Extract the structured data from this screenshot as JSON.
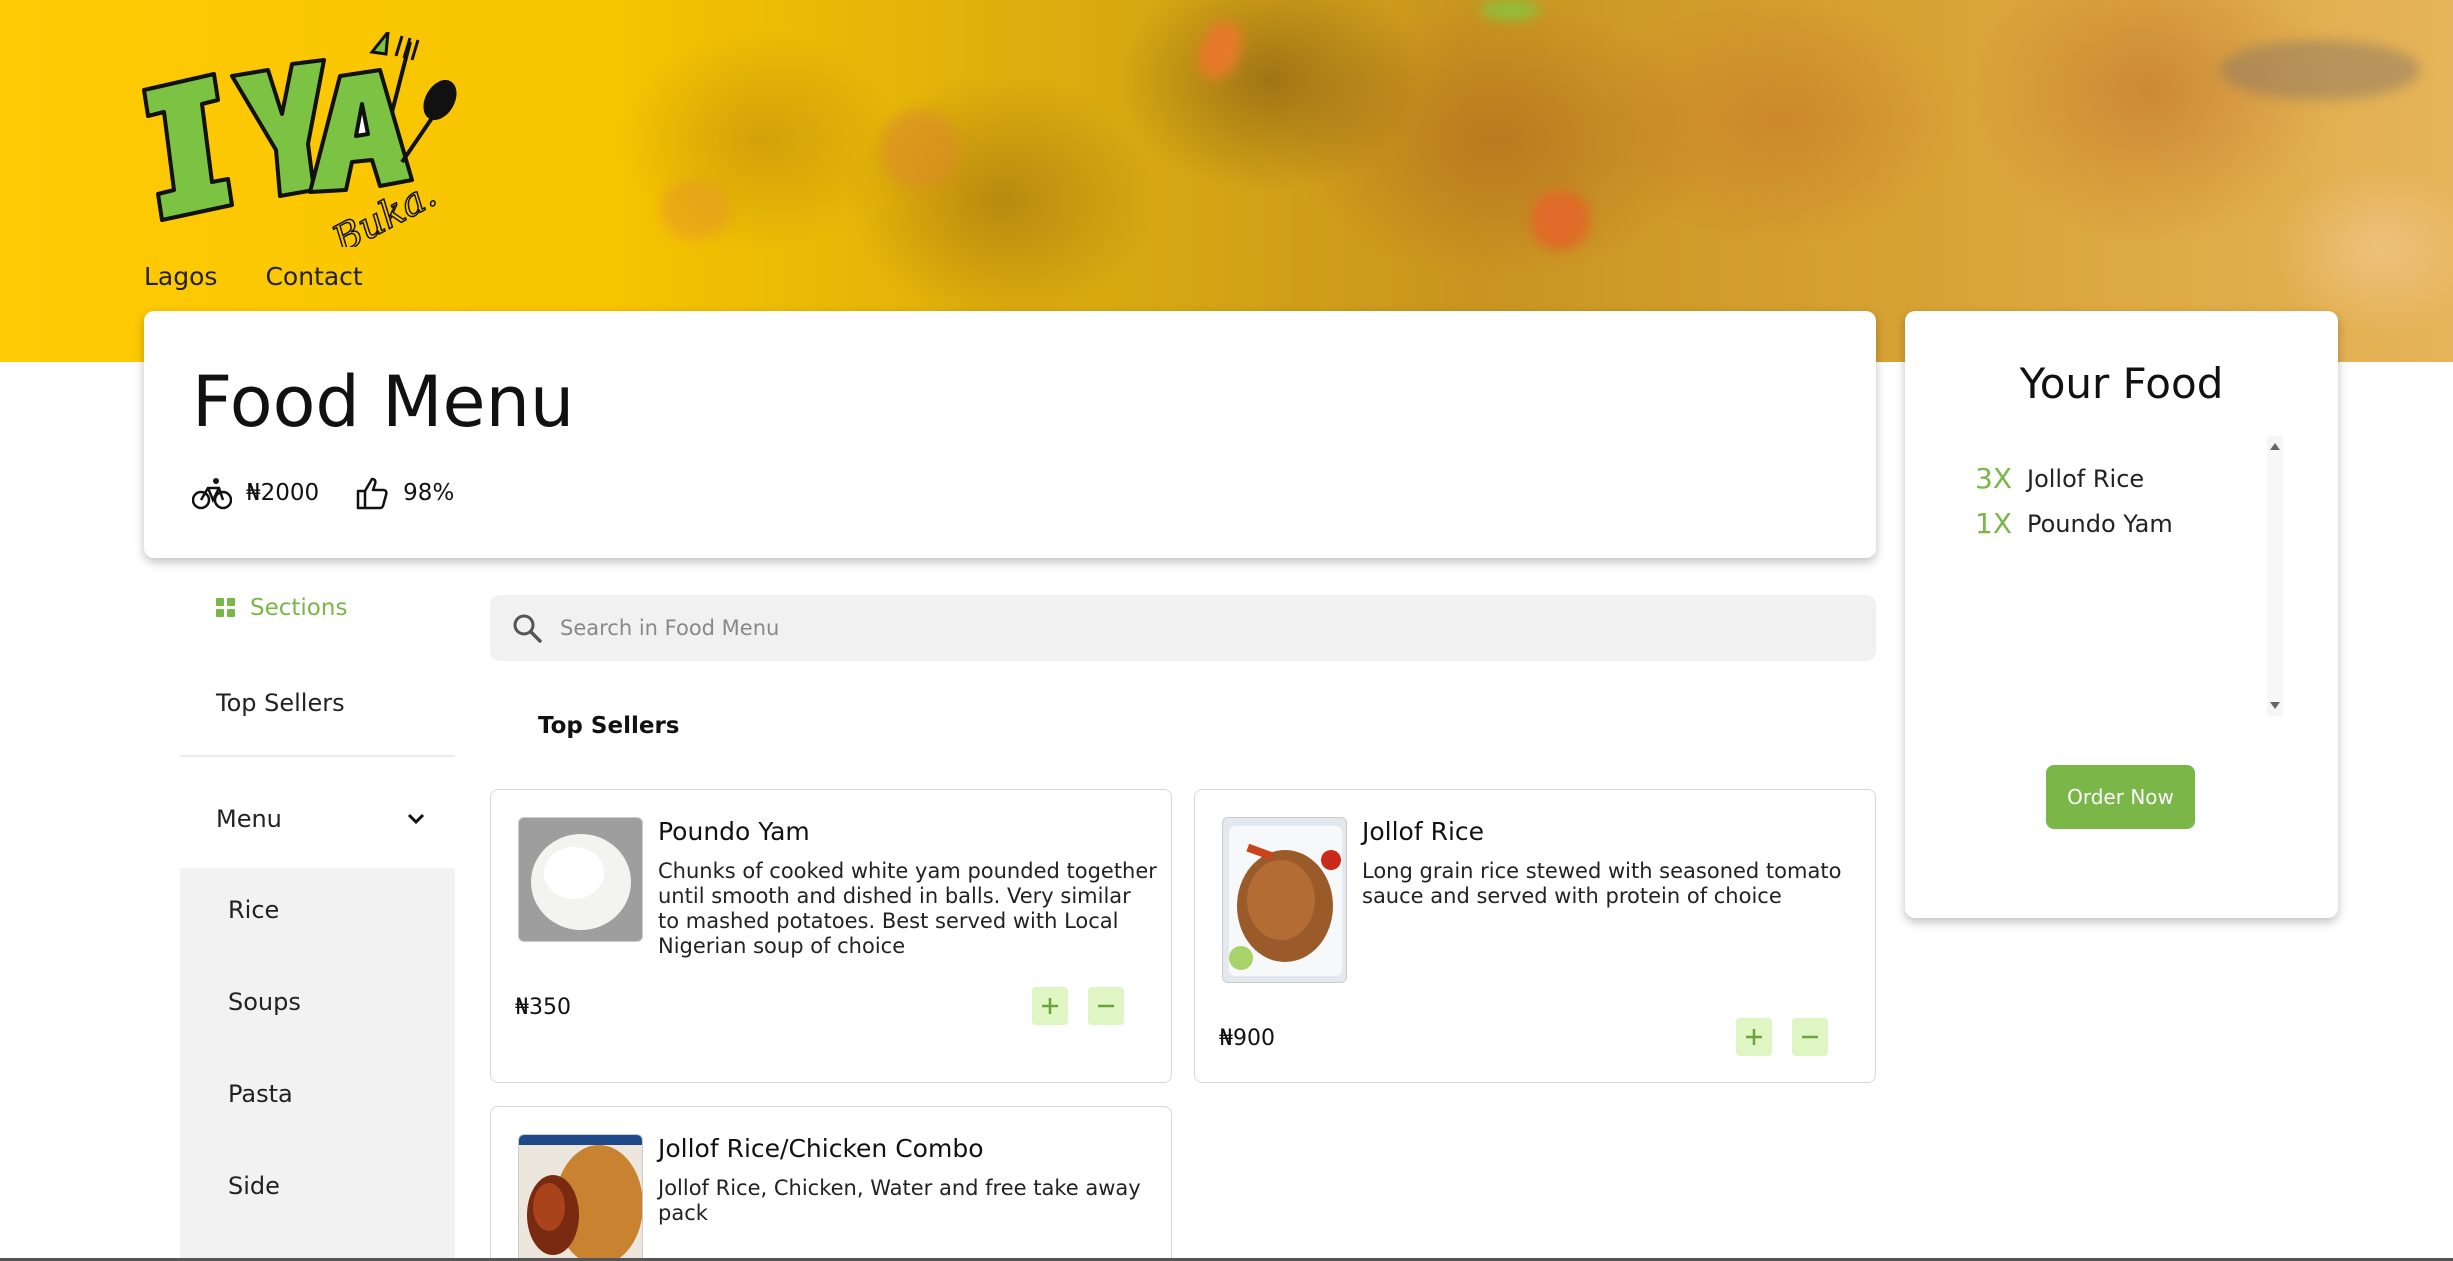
{
  "brand": {
    "logo_text": "IYA",
    "logo_sub": "Buka."
  },
  "top_nav": [
    {
      "label": "Lagos"
    },
    {
      "label": "Contact"
    }
  ],
  "header": {
    "title": "Food Menu",
    "delivery_fee": "₦2000",
    "rating": "98%"
  },
  "sidebar": {
    "sections_label": "Sections",
    "top_sellers": "Top Sellers",
    "menu_label": "Menu",
    "sub_items": [
      {
        "label": "Rice"
      },
      {
        "label": "Soups"
      },
      {
        "label": "Pasta"
      },
      {
        "label": "Side"
      }
    ]
  },
  "search": {
    "placeholder": "Search in Food Menu"
  },
  "section_heading": "Top Sellers",
  "items": [
    {
      "name": "Poundo Yam",
      "description": "Chunks of cooked white yam pounded together until smooth and dished in balls. Very similar to mashed potatoes. Best served with Local Nigerian soup of choice",
      "price": "₦350"
    },
    {
      "name": "Jollof Rice",
      "description": "Long grain rice stewed with seasoned tomato sauce and served with protein of choice",
      "price": "₦900"
    },
    {
      "name": "Jollof Rice/Chicken Combo",
      "description": "Jollof Rice, Chicken, Water and free take away pack",
      "price": ""
    }
  ],
  "order": {
    "title": "Your Food",
    "lines": [
      {
        "qty": "3X",
        "name": "Jollof Rice"
      },
      {
        "qty": "1X",
        "name": "Poundo Yam"
      }
    ],
    "button_label": "Order Now"
  },
  "colors": {
    "accent": "#7ab648",
    "button_bg": "#dff5c4",
    "hero_yellow": "#ffcb05"
  },
  "icons": [
    "bicycle-icon",
    "thumbs-up-icon",
    "grid-icon",
    "search-icon",
    "chevron-down-icon",
    "plus-icon",
    "minus-icon"
  ]
}
